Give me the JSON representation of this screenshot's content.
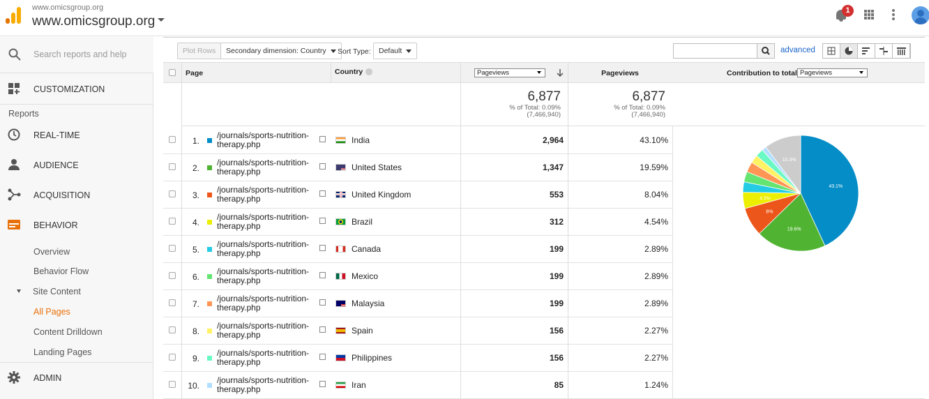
{
  "header": {
    "site_small": "www.omicsgroup.org",
    "site_big": "www.omicsgroup.org",
    "notification_count": "1",
    "logo_colors": [
      "#f9ab00",
      "#e37400"
    ]
  },
  "sidebar": {
    "search_placeholder": "Search reports and help",
    "customization": "CUSTOMIZATION",
    "reports": "Reports",
    "items": [
      {
        "label": "REAL-TIME",
        "icon": "clock-icon"
      },
      {
        "label": "AUDIENCE",
        "icon": "person-icon"
      },
      {
        "label": "ACQUISITION",
        "icon": "acquisition-icon"
      },
      {
        "label": "BEHAVIOR",
        "icon": "behavior-icon"
      }
    ],
    "behavior_sub": [
      "Overview",
      "Behavior Flow"
    ],
    "site_content": "Site Content",
    "site_content_sub": [
      "All Pages",
      "Content Drilldown",
      "Landing Pages"
    ],
    "active_color": "#e8710a",
    "admin": "ADMIN"
  },
  "toolbar": {
    "plot_rows": "Plot Rows",
    "secondary_dimension": "Secondary dimension: Country",
    "sort_type_label": "Sort Type:",
    "sort_type_value": "Default",
    "advanced": "advanced"
  },
  "table": {
    "col_page": "Page",
    "col_country": "Country",
    "col_metric_select": "Pageviews",
    "col_pageviews": "Pageviews",
    "contribution_label": "Contribution to total:",
    "contribution_select": "Pageviews",
    "totals": [
      {
        "value": "6,877",
        "line1": "% of Total: 0.09%",
        "line2": "(7,466,940)"
      },
      {
        "value": "6,877",
        "line1": "% of Total: 0.09%",
        "line2": "(7,466,940)"
      }
    ],
    "rows": [
      {
        "num": "1.",
        "page": "/journals/sports-nutrition-therapy.php",
        "country": "India",
        "pageviews": "2,964",
        "pct": "43.10%",
        "color": "#058dc7"
      },
      {
        "num": "2.",
        "page": "/journals/sports-nutrition-therapy.php",
        "country": "United States",
        "pageviews": "1,347",
        "pct": "19.59%",
        "color": "#50b432"
      },
      {
        "num": "3.",
        "page": "/journals/sports-nutrition-therapy.php",
        "country": "United Kingdom",
        "pageviews": "553",
        "pct": "8.04%",
        "color": "#ed561b"
      },
      {
        "num": "4.",
        "page": "/journals/sports-nutrition-therapy.php",
        "country": "Brazil",
        "pageviews": "312",
        "pct": "4.54%",
        "color": "#edef00"
      },
      {
        "num": "5.",
        "page": "/journals/sports-nutrition-therapy.php",
        "country": "Canada",
        "pageviews": "199",
        "pct": "2.89%",
        "color": "#24cbe5"
      },
      {
        "num": "6.",
        "page": "/journals/sports-nutrition-therapy.php",
        "country": "Mexico",
        "pageviews": "199",
        "pct": "2.89%",
        "color": "#64e572"
      },
      {
        "num": "7.",
        "page": "/journals/sports-nutrition-therapy.php",
        "country": "Malaysia",
        "pageviews": "199",
        "pct": "2.89%",
        "color": "#ff9655"
      },
      {
        "num": "8.",
        "page": "/journals/sports-nutrition-therapy.php",
        "country": "Spain",
        "pageviews": "156",
        "pct": "2.27%",
        "color": "#fff263"
      },
      {
        "num": "9.",
        "page": "/journals/sports-nutrition-therapy.php",
        "country": "Philippines",
        "pageviews": "156",
        "pct": "2.27%",
        "color": "#6af9c4"
      },
      {
        "num": "10.",
        "page": "/journals/sports-nutrition-therapy.php",
        "country": "Iran",
        "pageviews": "85",
        "pct": "1.24%",
        "color": "#b2deff"
      }
    ]
  },
  "pie": {
    "slices": [
      {
        "value": 43.1,
        "color": "#058dc7",
        "label": "43.1%"
      },
      {
        "value": 19.59,
        "color": "#50b432",
        "label": "19.6%"
      },
      {
        "value": 8.04,
        "color": "#ed561b",
        "label": "8%"
      },
      {
        "value": 4.54,
        "color": "#edef00",
        "label": "4.5%"
      },
      {
        "value": 2.89,
        "color": "#24cbe5",
        "label": ""
      },
      {
        "value": 2.89,
        "color": "#64e572",
        "label": ""
      },
      {
        "value": 2.89,
        "color": "#ff9655",
        "label": ""
      },
      {
        "value": 2.27,
        "color": "#fff263",
        "label": ""
      },
      {
        "value": 2.27,
        "color": "#6af9c4",
        "label": ""
      },
      {
        "value": 1.24,
        "color": "#b2deff",
        "label": ""
      },
      {
        "value": 10.28,
        "color": "#cccccc",
        "label": "10.3%"
      }
    ]
  }
}
